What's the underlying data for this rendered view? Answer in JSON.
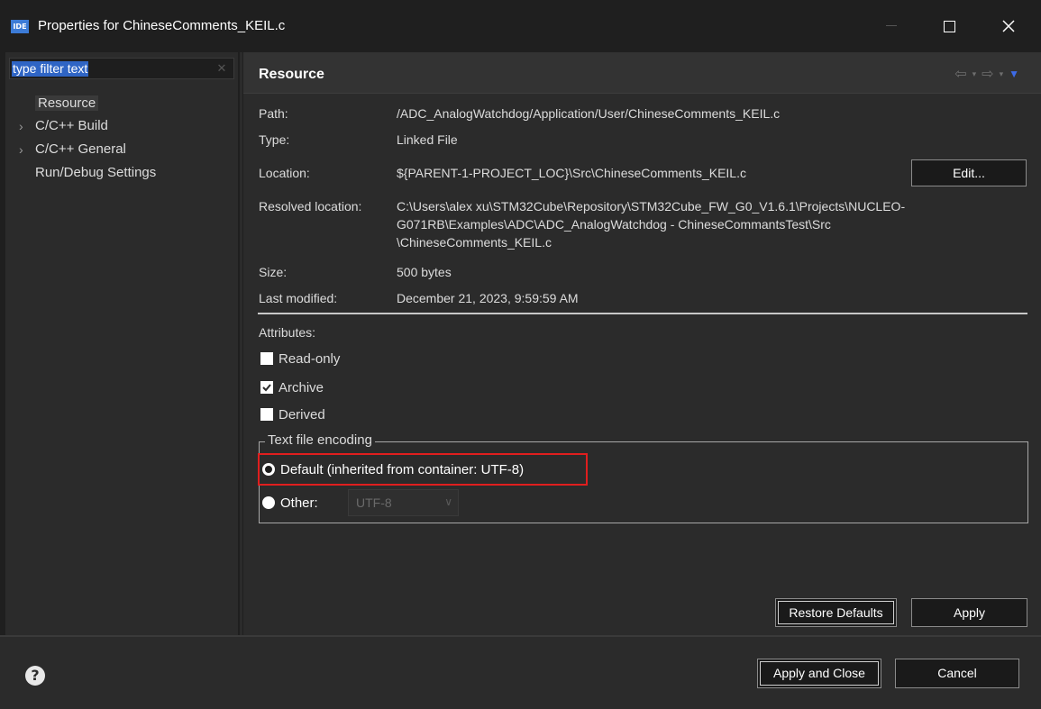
{
  "window": {
    "app_icon_text": "IDE",
    "title": "Properties for ChineseComments_KEIL.c"
  },
  "filter": {
    "placeholder": "type filter text"
  },
  "tree": {
    "items": [
      {
        "label": "Resource",
        "expandable": false,
        "selected": true
      },
      {
        "label": "C/C++ Build",
        "expandable": true,
        "selected": false
      },
      {
        "label": "C/C++ General",
        "expandable": true,
        "selected": false
      },
      {
        "label": "Run/Debug Settings",
        "expandable": false,
        "selected": false
      }
    ]
  },
  "page": {
    "title": "Resource"
  },
  "properties": {
    "path_label": "Path:",
    "path_value": "/ADC_AnalogWatchdog/Application/User/ChineseComments_KEIL.c",
    "type_label": "Type:",
    "type_value": "Linked File",
    "location_label": "Location:",
    "location_value": "${PARENT-1-PROJECT_LOC}\\Src\\ChineseComments_KEIL.c",
    "edit_button": "Edit...",
    "resolved_label": "Resolved location:",
    "resolved_line1": "C:\\Users\\alex xu\\STM32Cube\\Repository\\STM32Cube_FW_G0_V1.6.1\\Projects\\NUCLEO-",
    "resolved_line2": "G071RB\\Examples\\ADC\\ADC_AnalogWatchdog - ChineseCommantsTest\\Src",
    "resolved_line3": "\\ChineseComments_KEIL.c",
    "size_label": "Size:",
    "size_value": "500  bytes",
    "modified_label": "Last modified:",
    "modified_value": "December 21, 2023, 9:59:59 AM"
  },
  "attributes": {
    "heading": "Attributes:",
    "read_only": {
      "label": "Read-only",
      "checked": false
    },
    "archive": {
      "label": "Archive",
      "checked": true
    },
    "derived": {
      "label": "Derived",
      "checked": false
    }
  },
  "encoding": {
    "legend": "Text file encoding",
    "default_option": "Default (inherited from container: UTF-8)",
    "other_option": "Other:",
    "other_value": "UTF-8",
    "selected": "default",
    "highlight_color": "#e01e1e"
  },
  "buttons": {
    "restore_defaults": "Restore Defaults",
    "apply": "Apply",
    "apply_and_close": "Apply and Close",
    "cancel": "Cancel"
  }
}
